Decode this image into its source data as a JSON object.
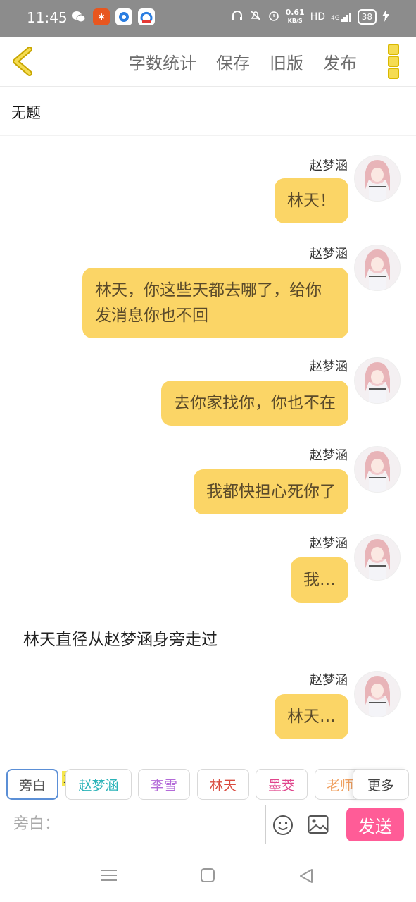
{
  "status_bar": {
    "time": "11:45",
    "net_speed_value": "0.61",
    "net_speed_unit": "KB/S",
    "hd": "HD",
    "signal": "4G",
    "battery": "38"
  },
  "toolbar": {
    "items": [
      "字数统计",
      "保存",
      "旧版",
      "发布"
    ]
  },
  "document": {
    "title": "无题"
  },
  "messages": [
    {
      "name": "赵梦涵",
      "text": "林天！"
    },
    {
      "name": "赵梦涵",
      "text": "林天，你这些天都去哪了，给你发消息你也不回"
    },
    {
      "name": "赵梦涵",
      "text": "去你家找你，你也不在"
    },
    {
      "name": "赵梦涵",
      "text": "我都快担心死你了"
    },
    {
      "name": "赵梦涵",
      "text": "我…"
    },
    {
      "narration": "林天直径从赵梦涵身旁走过"
    },
    {
      "name": "赵梦涵",
      "text": "林天…"
    }
  ],
  "roles": {
    "host_tag": "主",
    "chips": [
      {
        "label": "旁白",
        "color": "#555555"
      },
      {
        "label": "赵梦涵",
        "color": "#2bb3b8"
      },
      {
        "label": "李雪",
        "color": "#b36ad8"
      },
      {
        "label": "林天",
        "color": "#d94b3f"
      },
      {
        "label": "墨茭",
        "color": "#e0458c"
      },
      {
        "label": "老师",
        "color": "#f0a060"
      }
    ],
    "more_label": "更多"
  },
  "composer": {
    "placeholder": "旁白：",
    "send_label": "发送"
  },
  "colors": {
    "bubble": "#fbd566",
    "send": "#ff5c97",
    "accent_yellow": "#f5dc52"
  }
}
